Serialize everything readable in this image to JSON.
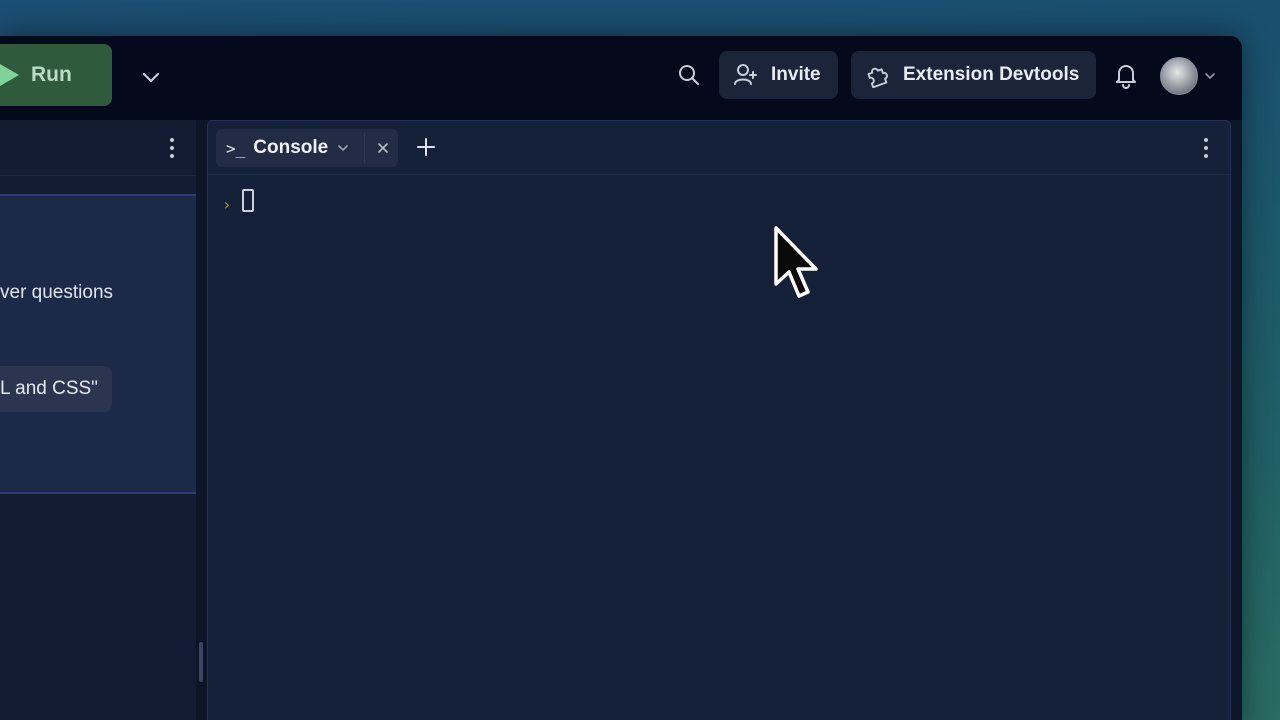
{
  "toolbar": {
    "run_label": "Run",
    "invite_label": "Invite",
    "extension_label": "Extension Devtools",
    "icons": [
      "play-icon",
      "chevron-down-icon",
      "search-icon",
      "add-user-icon",
      "puzzle-icon",
      "bell-icon",
      "avatar"
    ]
  },
  "left_panel": {
    "card_text": "ver questions",
    "chip_text": "L and CSS\""
  },
  "console": {
    "tab_label": "Console",
    "tab_icon_glyph": ">_",
    "prompt_symbol": "›"
  },
  "colors": {
    "run_button": "#2f5a3c",
    "background": "#0d1629",
    "console_bg": "#142139",
    "prompt": "#b58a2e"
  }
}
